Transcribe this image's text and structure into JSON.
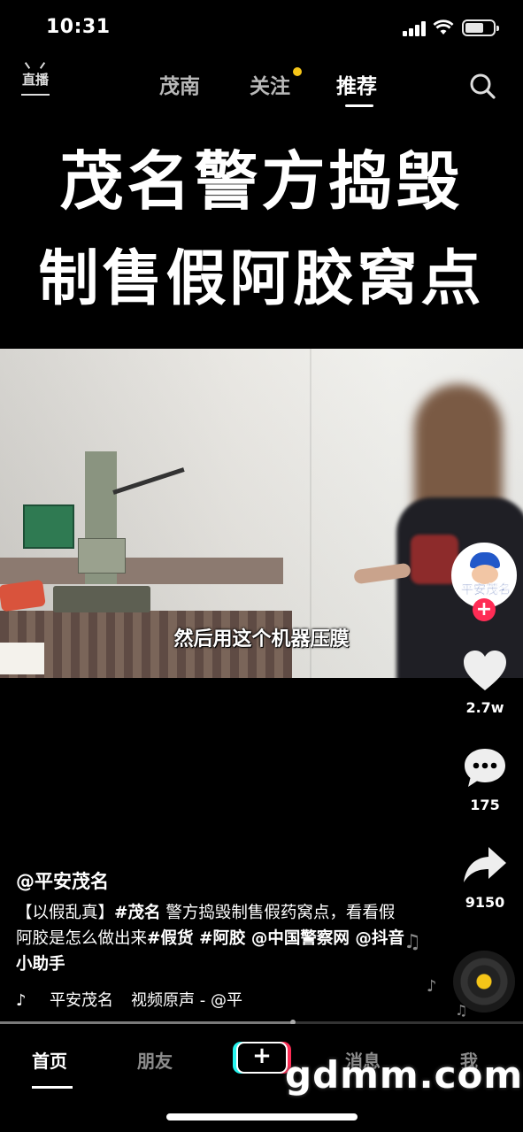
{
  "status_bar": {
    "time": "10:31"
  },
  "top_nav": {
    "live_label": "直播",
    "tabs": [
      {
        "label": "茂南",
        "active": false
      },
      {
        "label": "关注",
        "active": false,
        "has_dot": true
      },
      {
        "label": "推荐",
        "active": true
      }
    ]
  },
  "headline": {
    "line1": "茂名警方捣毁",
    "line2": "制售假阿胶窝点"
  },
  "video": {
    "subtitle": "然后用这个机器压膜"
  },
  "actions": {
    "avatar_text": "平安茂名",
    "likes": "2.7w",
    "comments": "175",
    "shares": "9150"
  },
  "caption": {
    "author": "@平安茂名",
    "desc_part1": "【以假乱真】",
    "tag1": "#茂名",
    "desc_part2": " 警方捣毁制售假药窝点，看看假阿胶是怎么做出来",
    "tag2": "#假货",
    "tag3": " #阿胶",
    "mention1": " @中国警察网",
    "mention2": " @抖音小助手"
  },
  "music": {
    "artist": "平安茂名",
    "track": "视频原声 - @平"
  },
  "progress": {
    "fraction": 0.56
  },
  "bottom_tabs": [
    {
      "label": "首页",
      "active": true
    },
    {
      "label": "朋友",
      "active": false
    },
    {
      "label": "+",
      "active": false
    },
    {
      "label": "消息",
      "active": false
    },
    {
      "label": "我",
      "active": false
    }
  ],
  "watermark": "gdmm.com",
  "colors": {
    "accent_red": "#fe2c55",
    "accent_cyan": "#25f4ee",
    "notify_dot": "#f5c518"
  }
}
